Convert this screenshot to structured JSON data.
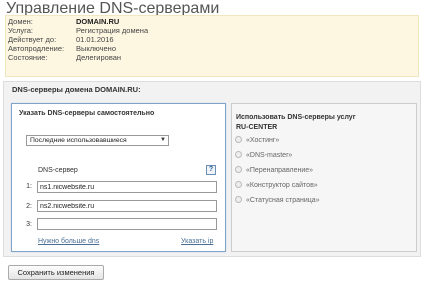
{
  "page_title": "Управление DNS-серверами",
  "info": {
    "domain_label": "Домен:",
    "domain_value": "DOMAIN.RU",
    "service_label": "Услуга:",
    "service_value": "Регистрация домена",
    "valid_label": "Действует до:",
    "valid_value": "01.01.2016",
    "autorenew_label": "Автопродление:",
    "autorenew_value": "Выключено",
    "state_label": "Состояние:",
    "state_value": "Делегирован"
  },
  "dns_section": {
    "title": "DNS-серверы домена DOMAIN.RU:"
  },
  "manual": {
    "title": "Указать DNS-серверы самостоятельно",
    "select_value": "Последние использовавшиеся",
    "dns_server_label": "DNS-сервер",
    "help_glyph": "?",
    "rows": [
      {
        "num": "1:",
        "value": "ns1.nicwebsite.ru"
      },
      {
        "num": "2:",
        "value": "ns2.nicwebsite.ru"
      },
      {
        "num": "3:",
        "value": ""
      }
    ],
    "more_link": "Нужно больше dns",
    "ip_link": "Указать ip"
  },
  "rucenter": {
    "title_line1": "Использовать DNS-серверы услуг",
    "title_line2": "RU-CENTER",
    "options": [
      "«Хостинг»",
      "«DNS-master»",
      "«Перенаправление»",
      "«Конструктор сайтов»",
      "«Статусная страница»"
    ]
  },
  "save_button": "Сохранить изменения"
}
